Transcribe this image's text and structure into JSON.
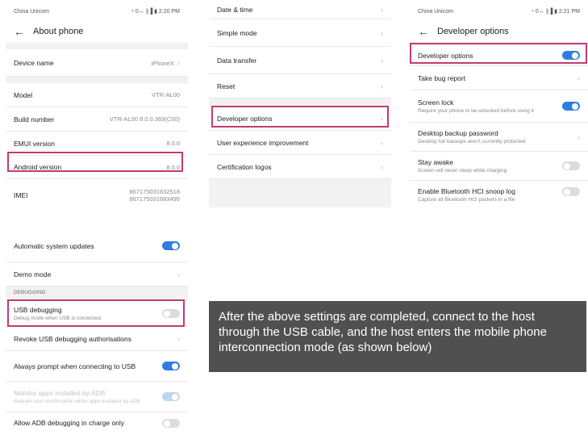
{
  "panel1": {
    "status_carrier": "China Unicom",
    "status_right": "◔ 0↔ ∥▐ ▮ 2:20 PM",
    "title": "About phone",
    "rows": [
      {
        "label": "Device name",
        "value": "iPhoneX"
      },
      {
        "label": "Model",
        "value": "VTR-AL00"
      },
      {
        "label": "Build number",
        "value": "VTR-AL00 8.0.0.369(C00)"
      },
      {
        "label": "EMUI version",
        "value": "8.0.0"
      },
      {
        "label": "Android version",
        "value": "8.0.0"
      },
      {
        "label": "IMEI",
        "value": "867175031632518",
        "value2": "867175031683495"
      }
    ]
  },
  "panel2": {
    "rows": [
      {
        "label": "Date & time"
      },
      {
        "label": "Simple mode"
      },
      {
        "label": "Data transfer"
      },
      {
        "label": "Reset"
      },
      {
        "label": "Developer options"
      },
      {
        "label": "User experience improvement"
      },
      {
        "label": "Certification logos"
      }
    ]
  },
  "panel3": {
    "status_carrier": "China Unicom",
    "status_right": "◔ 0↔ ∥▐ ▮ 2:21 PM",
    "title": "Developer options",
    "rows": [
      {
        "label": "Developer options",
        "toggle": "on"
      },
      {
        "label": "Take bug report"
      },
      {
        "label": "Screen lock",
        "sub": "Require your phone to be unlocked before using it",
        "toggle": "on"
      },
      {
        "label": "Desktop backup password",
        "sub": "Desktop full backups aren't currently protected"
      },
      {
        "label": "Stay awake",
        "sub": "Screen will never sleep while charging",
        "toggle": "off"
      },
      {
        "label": "Enable Bluetooth HCI snoop log",
        "sub": "Capture all Bluetooth HCI packets in a file",
        "toggle": "off"
      }
    ]
  },
  "panel4": {
    "rows": [
      {
        "label": "Automatic system updates",
        "toggle": "on"
      },
      {
        "label": "Demo mode"
      }
    ],
    "section": "DEBUGGING",
    "debug_rows": [
      {
        "label": "USB debugging",
        "sub": "Debug mode when USB is connected",
        "toggle": "off"
      },
      {
        "label": "Revoke USB debugging authorisations"
      },
      {
        "label": "Always prompt when connecting to USB",
        "toggle": "on"
      },
      {
        "label": "Monitor apps installed by ADB",
        "sub": "Require user confirmation when apps installed by ADB",
        "toggle": "dim"
      },
      {
        "label": "Allow ADB debugging in charge only",
        "toggle": "off"
      }
    ]
  },
  "note": "After the above settings are completed, connect to the host through the USB cable, and the host enters the mobile phone interconnection mode (as shown below)"
}
